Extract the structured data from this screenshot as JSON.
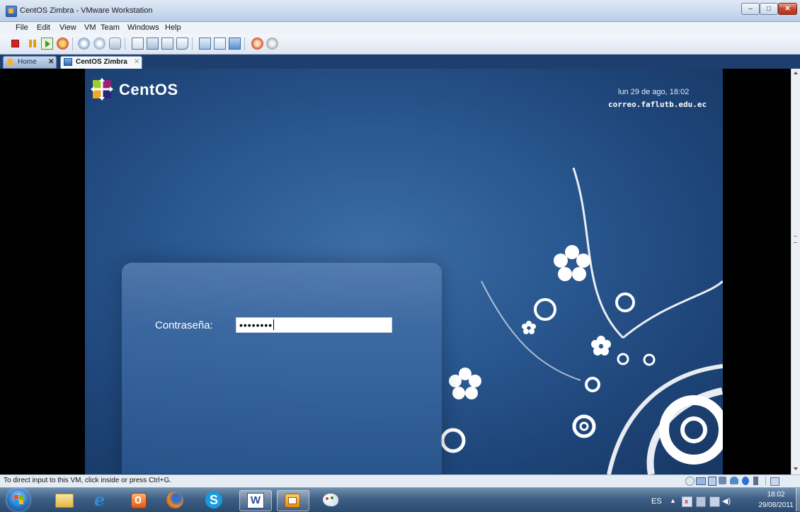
{
  "window": {
    "title": "CentOS Zimbra - VMware Workstation",
    "controls": {
      "minimize": "–",
      "maximize": "□",
      "close": "✕"
    }
  },
  "menu": [
    "File",
    "Edit",
    "View",
    "VM",
    "Team",
    "Windows",
    "Help"
  ],
  "toolbar_icons": [
    "power-off-icon",
    "suspend-icon",
    "power-on-icon",
    "reset-icon",
    "snapshot-icon",
    "revert-snapshot-icon",
    "snapshot-manager-icon",
    "full-screen-icon",
    "quick-switch-icon",
    "unity-icon",
    "console-view-icon",
    "thumbnail-icon",
    "summary-view-icon",
    "appliance-view-icon",
    "team-icon",
    "clone-icon"
  ],
  "tabs": [
    {
      "label": "Home",
      "close": "✕"
    },
    {
      "label": "CentOS Zimbra",
      "close": "✕"
    }
  ],
  "vm": {
    "logo_text": "CentOS",
    "datetime": "lun 29 de ago, 18:02",
    "hostname": "correo.faflutb.edu.ec",
    "password_label": "Contraseña:",
    "password_value": "••••••••"
  },
  "status_text": "To direct input to this VM, click inside or press Ctrl+G.",
  "taskbar": {
    "apps": [
      "start-orb-icon",
      "file-explorer-icon",
      "internet-explorer-icon",
      "media-player-icon",
      "firefox-icon",
      "skype-icon",
      "word-icon",
      "vmware-icon",
      "paint-icon"
    ],
    "language": "ES",
    "time": "18:02",
    "date": "29/08/2011"
  },
  "colors": {
    "vm_background": "#1e4579",
    "taskbar": "#3e5f84",
    "tab_strip": "#1e3f6e"
  }
}
